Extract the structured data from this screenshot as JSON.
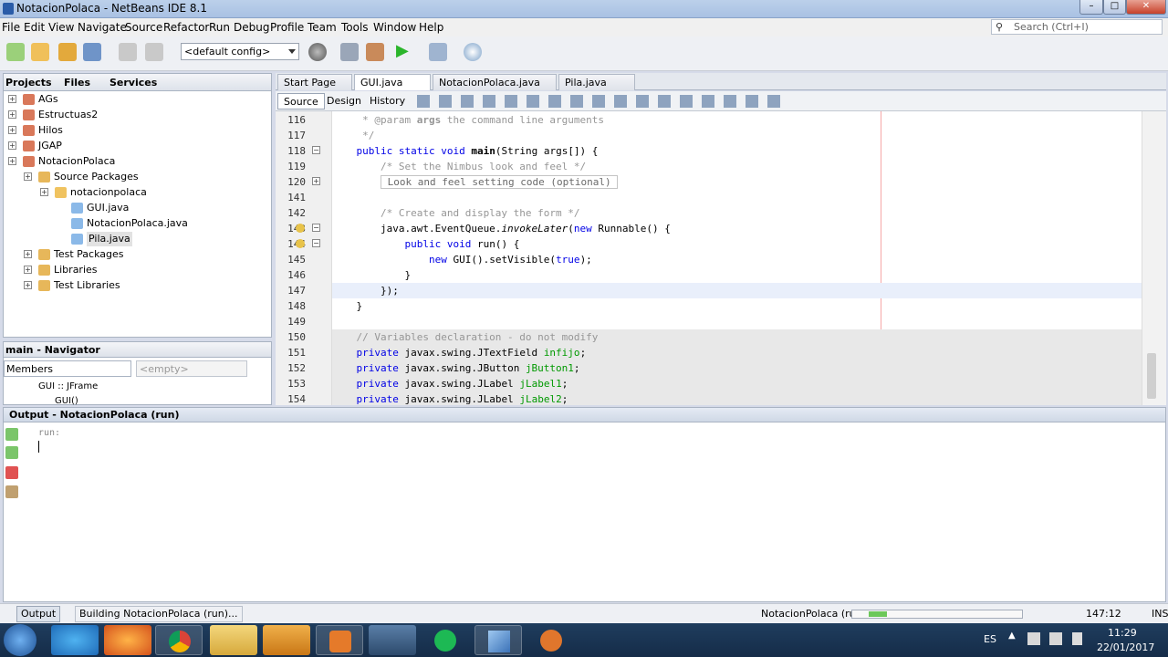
{
  "window": {
    "title": "NotacionPolaca - NetBeans IDE 8.1",
    "minimize": "–",
    "maximize": "□",
    "close": "✕"
  },
  "menu": [
    "File",
    "Edit",
    "View",
    "Navigate",
    "Source",
    "Refactor",
    "Run",
    "Debug",
    "Profile",
    "Team",
    "Tools",
    "Window",
    "Help"
  ],
  "search": {
    "placeholder": "Search (Ctrl+I)"
  },
  "toolbar": {
    "config": "<default config>"
  },
  "projects_panel": {
    "tabs": [
      "Projects",
      "Files",
      "Services"
    ],
    "tree": [
      {
        "label": "AGs"
      },
      {
        "label": "Estructuas2"
      },
      {
        "label": "Hilos"
      },
      {
        "label": "JGAP"
      },
      {
        "label": "NotacionPolaca"
      },
      {
        "label": "Source Packages"
      },
      {
        "label": "notacionpolaca"
      },
      {
        "label": "GUI.java"
      },
      {
        "label": "NotacionPolaca.java"
      },
      {
        "label": "Pila.java"
      },
      {
        "label": "Test Packages"
      },
      {
        "label": "Libraries"
      },
      {
        "label": "Test Libraries"
      }
    ]
  },
  "navigator": {
    "title": "main - Navigator",
    "filter": "Members",
    "empty": "<empty>",
    "items": [
      "GUI :: JFrame",
      "GUI()"
    ]
  },
  "editor": {
    "tabs": [
      "Start Page",
      "GUI.java",
      "NotacionPolaca.java",
      "Pila.java"
    ],
    "modes": [
      "Source",
      "Design",
      "History"
    ],
    "lines": [
      {
        "n": "116",
        "parts": [
          {
            "t": "     * @param ",
            "c": "cm"
          },
          {
            "t": "args",
            "c": "cm fn"
          },
          {
            "t": " the command line arguments",
            "c": "cm"
          }
        ]
      },
      {
        "n": "117",
        "parts": [
          {
            "t": "     */",
            "c": "cm"
          }
        ]
      },
      {
        "n": "118",
        "parts": [
          {
            "t": "    "
          },
          {
            "t": "public static void ",
            "c": "kw"
          },
          {
            "t": "main",
            "c": "fn"
          },
          {
            "t": "(String args[]) {"
          }
        ]
      },
      {
        "n": "119",
        "parts": [
          {
            "t": "        /* Set the Nimbus look and feel */",
            "c": "cm"
          }
        ]
      },
      {
        "n": "120",
        "parts": [
          {
            "t": "        "
          },
          {
            "t": " Look and feel setting code (optional) ",
            "c": "box"
          }
        ]
      },
      {
        "n": "141",
        "parts": [
          {
            "t": ""
          }
        ]
      },
      {
        "n": "142",
        "parts": [
          {
            "t": "        /* Create and display the form */",
            "c": "cm"
          }
        ]
      },
      {
        "n": "143",
        "parts": [
          {
            "t": "        java.awt.EventQueue."
          },
          {
            "t": "invokeLater",
            "c": "it"
          },
          {
            "t": "("
          },
          {
            "t": "new ",
            "c": "kw"
          },
          {
            "t": "Runnable() {"
          }
        ]
      },
      {
        "n": "144",
        "parts": [
          {
            "t": "            "
          },
          {
            "t": "public void ",
            "c": "kw"
          },
          {
            "t": "run() {"
          }
        ]
      },
      {
        "n": "145",
        "parts": [
          {
            "t": "                "
          },
          {
            "t": "new ",
            "c": "kw"
          },
          {
            "t": "GUI().setVisible("
          },
          {
            "t": "true",
            "c": "kw"
          },
          {
            "t": ");"
          }
        ]
      },
      {
        "n": "146",
        "parts": [
          {
            "t": "            }"
          }
        ]
      },
      {
        "n": "147",
        "parts": [
          {
            "t": "        });"
          }
        ]
      },
      {
        "n": "148",
        "parts": [
          {
            "t": "    }"
          }
        ]
      },
      {
        "n": "149",
        "parts": [
          {
            "t": ""
          }
        ]
      },
      {
        "n": "150",
        "parts": [
          {
            "t": "    // Variables declaration - do not modify",
            "c": "cm"
          }
        ]
      },
      {
        "n": "151",
        "parts": [
          {
            "t": "    "
          },
          {
            "t": "private ",
            "c": "kw"
          },
          {
            "t": "javax.swing.JTextField "
          },
          {
            "t": "infijo",
            "c": "fd"
          },
          {
            "t": ";"
          }
        ]
      },
      {
        "n": "152",
        "parts": [
          {
            "t": "    "
          },
          {
            "t": "private ",
            "c": "kw"
          },
          {
            "t": "javax.swing.JButton "
          },
          {
            "t": "jButton1",
            "c": "fd"
          },
          {
            "t": ";"
          }
        ]
      },
      {
        "n": "153",
        "parts": [
          {
            "t": "    "
          },
          {
            "t": "private ",
            "c": "kw"
          },
          {
            "t": "javax.swing.JLabel "
          },
          {
            "t": "jLabel1",
            "c": "fd"
          },
          {
            "t": ";"
          }
        ]
      },
      {
        "n": "154",
        "parts": [
          {
            "t": "    "
          },
          {
            "t": "private ",
            "c": "kw"
          },
          {
            "t": "javax.swing.JLabel "
          },
          {
            "t": "jLabel2",
            "c": "fd"
          },
          {
            "t": ";"
          }
        ]
      }
    ]
  },
  "output": {
    "title": "Output - NotacionPolaca (run)",
    "text": "run:"
  },
  "status": {
    "tab": "Output",
    "building": "Building NotacionPolaca (run)...",
    "project": "NotacionPolaca (run)",
    "position": "147:12",
    "mode": "INS"
  },
  "taskbar": {
    "lang": "ES",
    "time": "11:29",
    "date": "22/01/2017"
  },
  "colors": {
    "keyword": "#0000e6",
    "comment": "#969696",
    "field": "#009900",
    "taskbar": "#1f3d5e"
  }
}
